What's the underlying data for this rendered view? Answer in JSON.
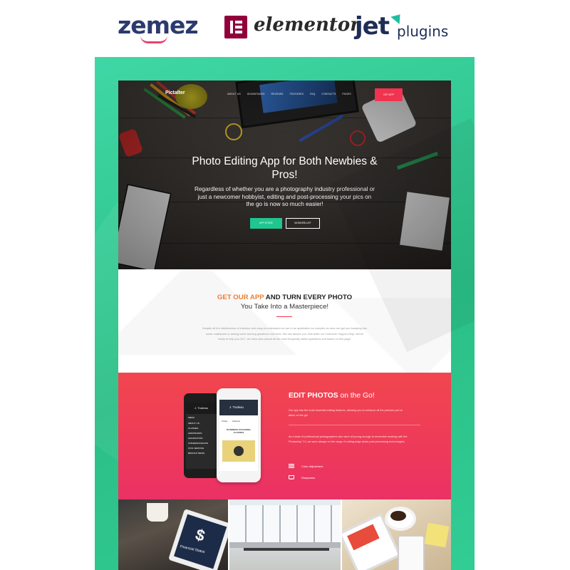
{
  "brands": {
    "zemez": "zemez",
    "elementor": "elementor",
    "jet": "JET",
    "plugins": "plugins"
  },
  "site": {
    "logo": "Pictalter",
    "nav": [
      "ABOUT US",
      "ADVANTAGES",
      "REVIEWS",
      "FEATURES",
      "FAQ",
      "CONTACTS",
      "PAGES"
    ],
    "nav_button": "GET APP"
  },
  "hero": {
    "title": "Photo Editing App for Both Newbies & Pros!",
    "text": "Regardless of whether you are a photography industry professional or just a newcomer hobbyist, editing and post-processing your pics on the go is now so much easier!",
    "button_primary": "APP STORE",
    "button_secondary": "WONDERLUST"
  },
  "about": {
    "heading_accent": "GET OUR APP",
    "heading_rest": " AND TURN EVERY PHOTO",
    "subheading": "You Take Into a Masterpiece!",
    "paragraph": "Despite all the intuitiveness of interface and easy-to-understand on use in an application so complex as ours can get you bumping into some roadblocks or asking some burning questions over time. We can assure you, that while our Customer Support Dept. will be ready to help you 24/7, we have also placed all the most frequently asked questions and based on this page."
  },
  "edit": {
    "heading_bold": "EDIT PHOTOS",
    "heading_rest": " on the Go!",
    "paragraph1": "Our app has the most essential editing features, allowing you to enhance all the pictures you've taken on the go!",
    "paragraph2": "As a team of professional photographers who were all young enough to remember working with the Photoshop 7.0, we were always on the verge of cutting-edge photo post-processing technologies.",
    "features": [
      "Color Adjustment",
      "Sharpness"
    ],
    "phone_brand": "J. Trudeau",
    "phone_menu": "MENU",
    "phone_items": [
      "ABOUT US",
      "CLASSES",
      "ADMISSIONS",
      "GRADUATION",
      "UNDERGRADUATE",
      "CIVIL SERVICE",
      "BRANCH NEWS"
    ],
    "phone_card": "BUSINESS COACHING CLASSES",
    "phone_tab1": "Today",
    "phone_tab2": "Classes"
  },
  "photos": {
    "tablet_text": "Financial Status"
  },
  "colors": {
    "frame": "#2bbf86",
    "accent_red": "#f0334f",
    "accent_green": "#20c68f",
    "accent_orange": "#f07b2f"
  }
}
